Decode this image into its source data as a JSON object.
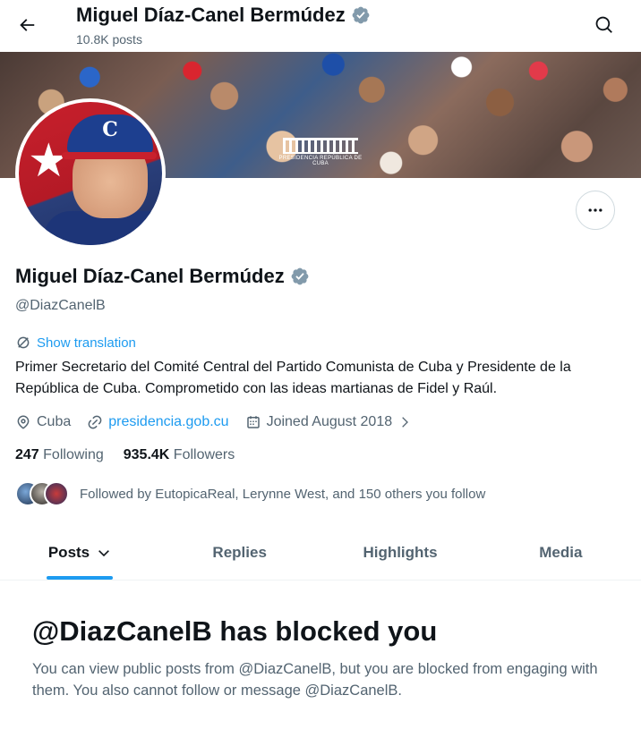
{
  "header": {
    "name": "Miguel Díaz-Canel Bermúdez",
    "post_count": "10.8K posts"
  },
  "banner": {
    "logo_text": "PRESIDENCIA REPÚBLICA DE CUBA"
  },
  "profile": {
    "name": "Miguel Díaz-Canel Bermúdez",
    "handle": "@DiazCanelB",
    "verified": true,
    "verified_color": "#829aab",
    "show_translation": "Show translation",
    "bio": "Primer Secretario del Comité Central del Partido Comunista de Cuba y Presidente de la República de Cuba. Comprometido con las ideas martianas de Fidel y Raúl.",
    "location": "Cuba",
    "website": "presidencia.gob.cu",
    "joined": "Joined August 2018",
    "following_count": "247",
    "following_label": "Following",
    "followers_count": "935.4K",
    "followers_label": "Followers",
    "followed_by": "Followed by EutopicaReal, Lerynne West, and 150 others you follow"
  },
  "tabs": [
    {
      "label": "Posts",
      "active": true
    },
    {
      "label": "Replies",
      "active": false
    },
    {
      "label": "Highlights",
      "active": false
    },
    {
      "label": "Media",
      "active": false
    }
  ],
  "blocked": {
    "title": "@DiazCanelB has blocked you",
    "description": "You can view public posts from @DiazCanelB, but you are blocked from engaging with them. You also cannot follow or message @DiazCanelB."
  },
  "icons": {
    "back": "arrow-left-icon",
    "search": "search-icon",
    "more": "more-icon",
    "verified": "verified-badge-icon",
    "translate": "translate-icon",
    "location": "location-pin-icon",
    "link": "link-icon",
    "calendar": "calendar-icon"
  },
  "colors": {
    "accent": "#1d9bf0",
    "text_primary": "#0f1419",
    "text_secondary": "#536471"
  }
}
